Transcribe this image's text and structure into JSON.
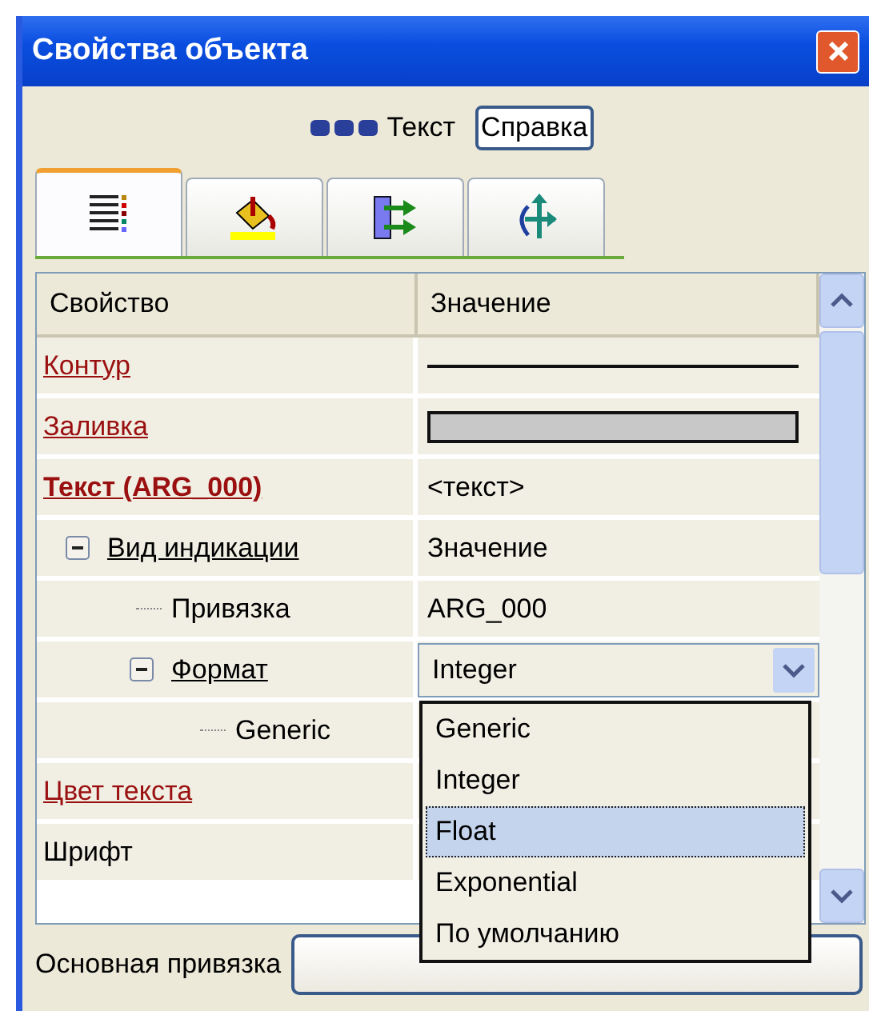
{
  "window": {
    "title": "Свойства объекта"
  },
  "header": {
    "type_label": "Текст",
    "help_button": "Справка"
  },
  "tabs": [
    {
      "kind": "list",
      "selected": true
    },
    {
      "kind": "paint",
      "selected": false
    },
    {
      "kind": "connect",
      "selected": false
    },
    {
      "kind": "move",
      "selected": false
    }
  ],
  "grid": {
    "columns": [
      "Свойство",
      "Значение"
    ],
    "rows": [
      {
        "name": "Контур",
        "kind": "line"
      },
      {
        "name": "Заливка",
        "kind": "fill"
      },
      {
        "name": "Текст (ARG_000)",
        "kind": "main",
        "value": "<текст>",
        "children": [
          {
            "name": "Вид индикации",
            "kind": "group",
            "expanded": true,
            "value": "Значение",
            "children": [
              {
                "name": "Привязка",
                "kind": "plain",
                "value": "ARG_000"
              },
              {
                "name": "Формат",
                "kind": "dropdown",
                "expanded": true,
                "value": "Integer",
                "children": [
                  {
                    "name": "Generic",
                    "kind": "plain"
                  }
                ]
              }
            ]
          }
        ]
      },
      {
        "name": "Цвет текста",
        "kind": "link"
      },
      {
        "name": "Шрифт",
        "kind": "plain"
      }
    ]
  },
  "dropdown": {
    "options": [
      {
        "label": "Generic",
        "selected": false
      },
      {
        "label": "Integer",
        "selected": false
      },
      {
        "label": "Float",
        "selected": true
      },
      {
        "label": "Exponential",
        "selected": false
      },
      {
        "label": "По умолчанию",
        "selected": false
      }
    ]
  },
  "footer": {
    "label": "Основная привязка"
  }
}
